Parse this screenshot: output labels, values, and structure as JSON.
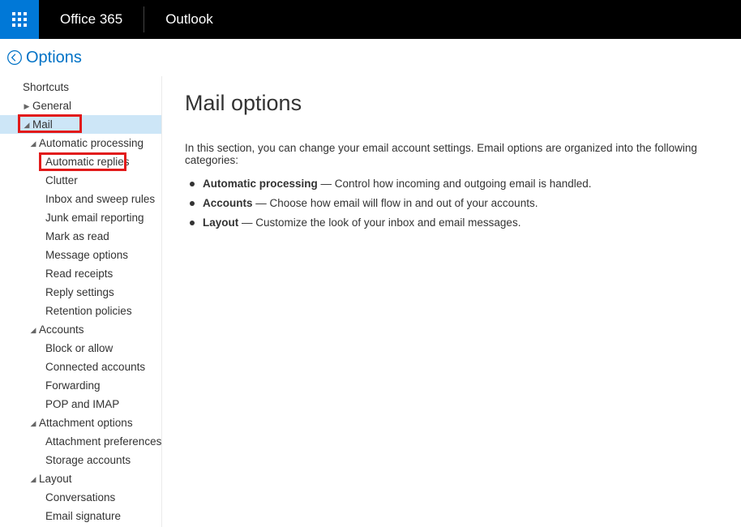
{
  "topbar": {
    "brand": "Office 365",
    "app": "Outlook"
  },
  "breadcrumb": {
    "title": "Options"
  },
  "sidebar": {
    "shortcuts_label": "Shortcuts",
    "general_label": "General",
    "mail_label": "Mail",
    "groups": {
      "automatic_processing": {
        "label": "Automatic processing",
        "items": [
          "Automatic replies",
          "Clutter",
          "Inbox and sweep rules",
          "Junk email reporting",
          "Mark as read",
          "Message options",
          "Read receipts",
          "Reply settings",
          "Retention policies"
        ]
      },
      "accounts": {
        "label": "Accounts",
        "items": [
          "Block or allow",
          "Connected accounts",
          "Forwarding",
          "POP and IMAP"
        ]
      },
      "attachment_options": {
        "label": "Attachment options",
        "items": [
          "Attachment preferences",
          "Storage accounts"
        ]
      },
      "layout": {
        "label": "Layout",
        "items": [
          "Conversations",
          "Email signature"
        ]
      }
    }
  },
  "content": {
    "heading": "Mail options",
    "intro": "In this section, you can change your email account settings. Email options are organized into the following categories:",
    "bullets": [
      {
        "strong": "Automatic processing",
        "dash": " — ",
        "rest": "Control how incoming and outgoing email is handled."
      },
      {
        "strong": "Accounts",
        "dash": " — ",
        "rest": "Choose how email will flow in and out of your accounts."
      },
      {
        "strong": "Layout",
        "dash": " — ",
        "rest": "Customize the look of your inbox and email messages."
      }
    ]
  }
}
